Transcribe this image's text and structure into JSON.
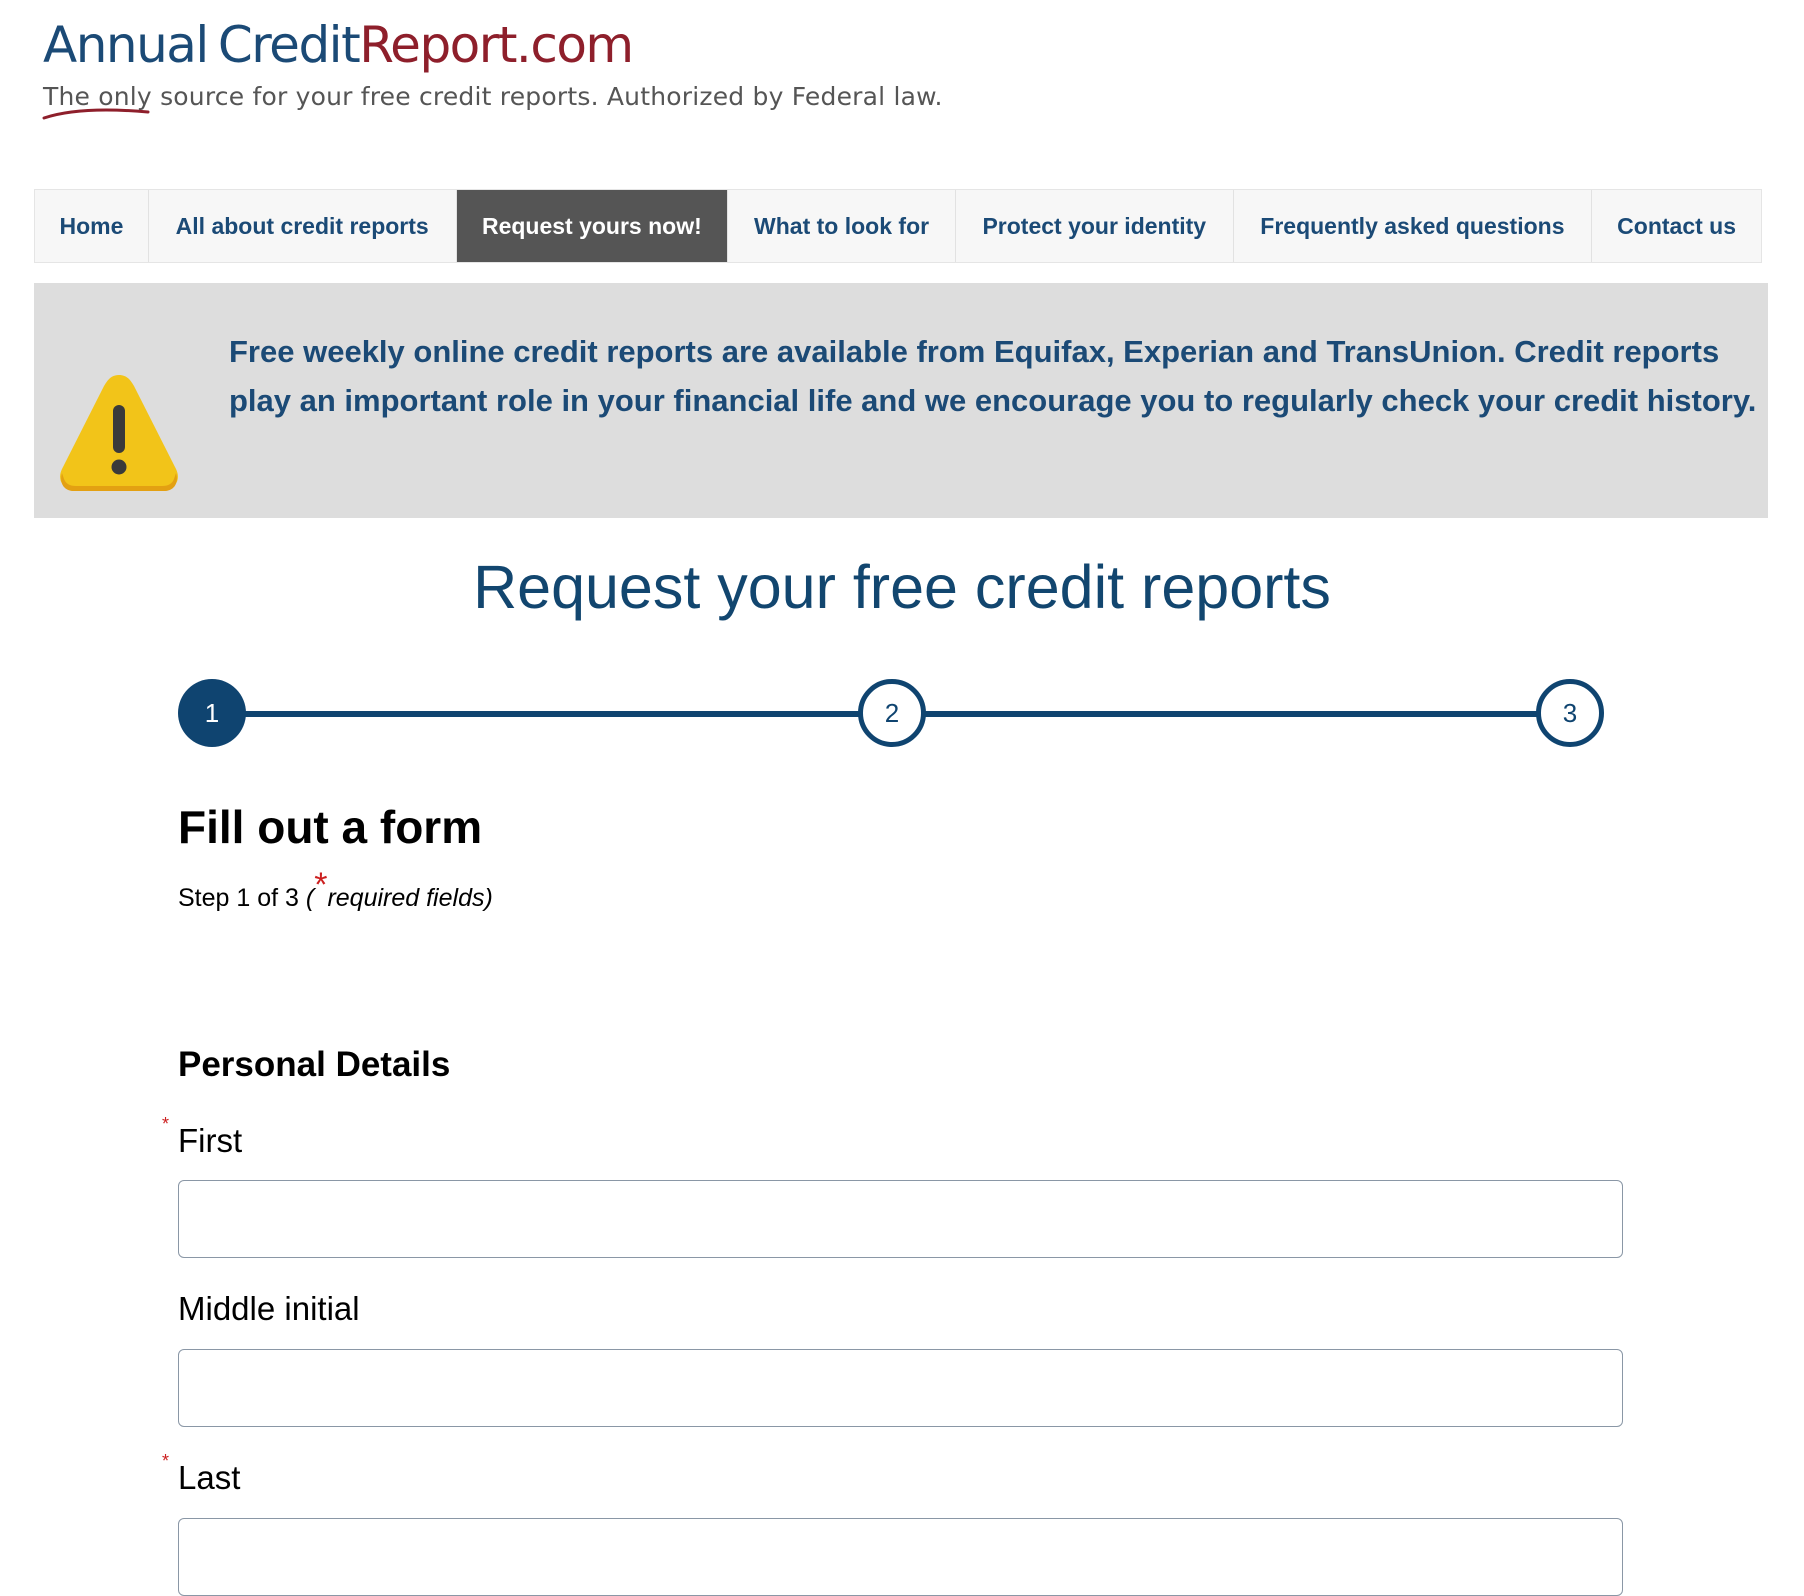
{
  "logo": {
    "part1": "Annual",
    "part2": "Credit",
    "part3": "Report.com"
  },
  "tagline": {
    "before": "The ",
    "emphasis": "only",
    "after": " source for your free credit reports. Authorized by Federal law."
  },
  "nav": {
    "items": [
      {
        "label": "Home"
      },
      {
        "label": "All about credit reports"
      },
      {
        "label": "Request yours now!",
        "active": true
      },
      {
        "label": "What to look for"
      },
      {
        "label": "Protect your identity"
      },
      {
        "label": "Frequently asked questions"
      },
      {
        "label": "Contact us"
      }
    ]
  },
  "alert": {
    "icon": "warning-icon",
    "text": "Free weekly online credit reports are available from Equifax, Experian and TransUnion. Credit reports play an important role in your financial life and we encourage you to regularly check your credit history."
  },
  "main": {
    "title": "Request your free credit reports",
    "steps": [
      "1",
      "2",
      "3"
    ],
    "current_step": 1,
    "form_heading": "Fill out a form",
    "step_note": {
      "prefix": "Step 1 of 3 ",
      "open": "(",
      "asterisk": "*",
      "rest": "required fields)"
    },
    "section": "Personal Details",
    "fields": {
      "first": {
        "label": "First",
        "required_mark": "*",
        "value": ""
      },
      "middle": {
        "label": "Middle initial",
        "value": ""
      },
      "last": {
        "label": "Last",
        "required_mark": "*",
        "value": ""
      }
    }
  },
  "colors": {
    "brand_blue": "#1b4a76",
    "brand_red": "#8e1f2b",
    "stepper": "#0f4470",
    "nav_active_bg": "#555555",
    "alert_bg": "#dddddd",
    "required": "#cc1f1f"
  }
}
